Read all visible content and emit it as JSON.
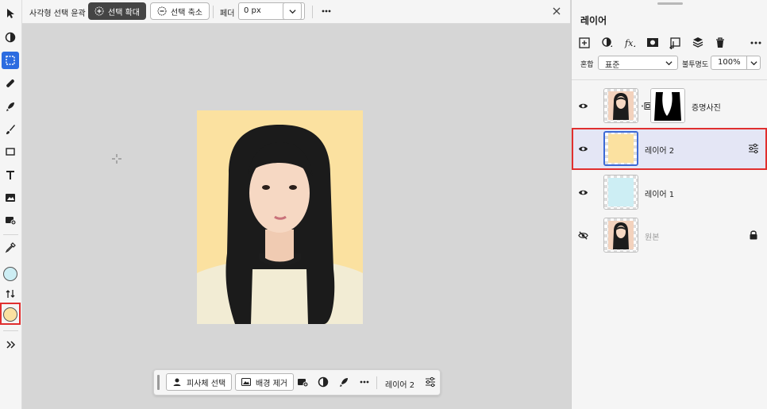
{
  "options_bar": {
    "tool_name": "사각형 선택 윤곽",
    "expand_label": "선택 확대",
    "contract_label": "선택 축소",
    "feather_label": "페더",
    "feather_value": "0 px"
  },
  "float_bar": {
    "select_subject_label": "피사체 선택",
    "remove_bg_label": "배경 제거",
    "layer_name": "레이어 2"
  },
  "panel": {
    "title": "레이어",
    "blend_label": "혼합",
    "blend_value": "표준",
    "opacity_label": "불투명도",
    "opacity_value": "100%",
    "layers": [
      {
        "name": "증명사진"
      },
      {
        "name": "레이어 2"
      },
      {
        "name": "레이어 1"
      },
      {
        "name": "원본"
      }
    ]
  },
  "colors": {
    "foreground": "#cdeef4",
    "background": "#fbe1a0",
    "accent": "#2c6ce0",
    "highlight_border": "#e02f2f"
  }
}
